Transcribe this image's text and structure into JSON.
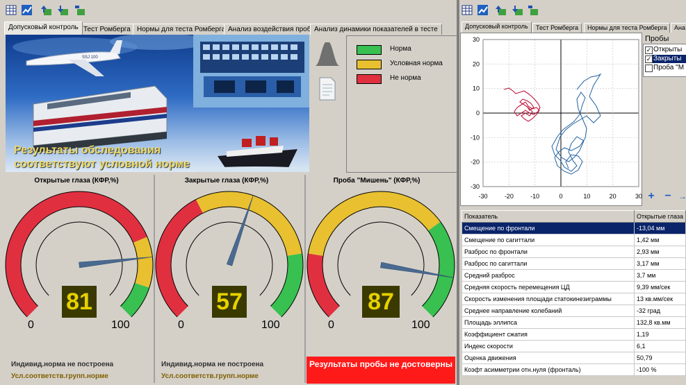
{
  "left_tabs": [
    "Допусковый контроль",
    "Тест Ромберга",
    "Нормы для теста Ромберга",
    "Анализ воздействия проб",
    "Анализ динамики показателей в тесте"
  ],
  "right_tabs": [
    "Допусковый контроль",
    "Тест Ромберга",
    "Нормы для теста Ромберга",
    "Ана"
  ],
  "banner": {
    "result_line1": "Результаты обследования",
    "result_line2": "соответствуют условной норме",
    "plane_logo": "SSJ 100"
  },
  "legend": [
    {
      "label": "Норма",
      "color": "#38c050"
    },
    {
      "label": "Условная норма",
      "color": "#e8c030"
    },
    {
      "label": "Не норма",
      "color": "#e03040"
    }
  ],
  "gauges": [
    {
      "title": "Открытые глаза (КФР,%)",
      "value": "81",
      "value_num": 81,
      "min": "0",
      "max": "100",
      "note1": "Индивид.норма не построена",
      "note2": "Усл.соответств.групп.норме"
    },
    {
      "title": "Закрытые глаза (КФР,%)",
      "value": "57",
      "value_num": 57,
      "min": "0",
      "max": "100",
      "note1": "Индивид.норма не построена",
      "note2": "Усл.соответств.групп.норме"
    },
    {
      "title": "Проба \"Мишень\" (КФР,%)",
      "value": "87",
      "value_num": 87,
      "min": "0",
      "max": "100",
      "warning": "Результаты пробы не достоверны"
    }
  ],
  "plot": {
    "y_ticks": [
      "30",
      "20",
      "10",
      "0",
      "-10",
      "-20",
      "-30"
    ],
    "x_ticks": [
      "-30",
      "-20",
      "-10",
      "0",
      "10",
      "20",
      "30"
    ],
    "red_color": "#c0143c",
    "blue_color": "#2060a0"
  },
  "probes": {
    "title": "Пробы",
    "items": [
      {
        "label": "Открыты",
        "checked": true
      },
      {
        "label": "Закрыты",
        "checked": true,
        "selected": true
      },
      {
        "label": "Проба \"М",
        "checked": false
      }
    ]
  },
  "table": {
    "headers": [
      "Показатель",
      "Открытые глаза"
    ],
    "rows": [
      [
        "Смещение по фронтали",
        "-13,04 мм"
      ],
      [
        "Смещение по сагиттали",
        "1,42 мм"
      ],
      [
        "Разброс по фронтали",
        "2,93 мм"
      ],
      [
        "Разброс по сагиттали",
        "3,17 мм"
      ],
      [
        "Средний разброс",
        "3,7 мм"
      ],
      [
        "Средняя скорость перемещения ЦД",
        "9,39 мм/сек"
      ],
      [
        "Скорость изменения площади статокинезиграммы",
        "13 кв.мм/сек"
      ],
      [
        "Среднее направление колебаний",
        "-32 град"
      ],
      [
        "Площадь эллипса",
        "132,8 кв.мм"
      ],
      [
        "Коэффициент сжатия",
        "1,19"
      ],
      [
        "Индекс скорости",
        "6,1"
      ],
      [
        "Оценка движения",
        "50,79"
      ],
      [
        "Коэфт асимметрии отн.нуля (фронталь)",
        "-100 %"
      ]
    ]
  }
}
